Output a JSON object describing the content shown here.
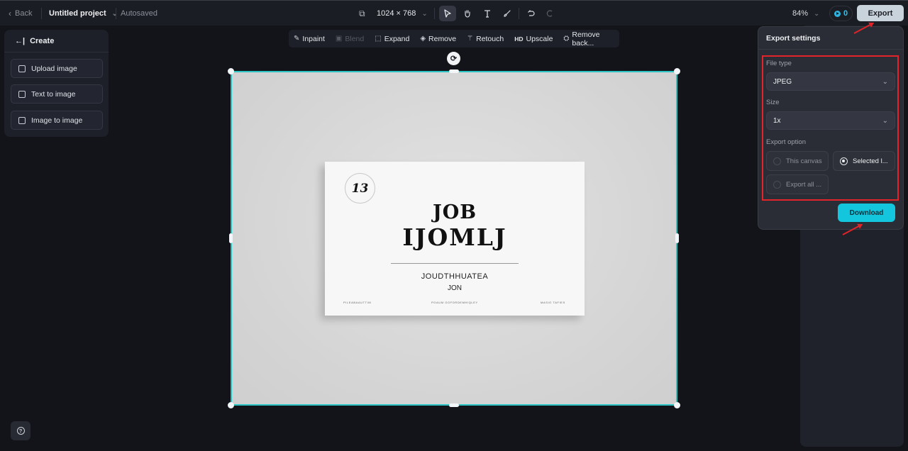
{
  "topbar": {
    "back_label": "Back",
    "project_name": "Untitled project",
    "save_status": "Autosaved",
    "canvas_size": "1024 × 768",
    "tools": [
      {
        "name": "select-tool",
        "icon": "cursor-icon",
        "active": true
      },
      {
        "name": "hand-tool",
        "icon": "hand-icon",
        "active": false
      },
      {
        "name": "text-tool",
        "icon": "text-icon",
        "active": false
      },
      {
        "name": "brush-tool",
        "icon": "brush-icon",
        "active": false
      }
    ],
    "undo_icon": "undo-icon",
    "redo_icon": "redo-icon",
    "zoom_level": "84%",
    "credits": "0",
    "export_label": "Export"
  },
  "create_panel": {
    "title": "Create",
    "items": [
      {
        "label": "Upload image",
        "icon": "upload-image-icon"
      },
      {
        "label": "Text to image",
        "icon": "text-to-image-icon"
      },
      {
        "label": "Image to image",
        "icon": "image-to-image-icon"
      }
    ]
  },
  "edit_toolbar": {
    "items": [
      {
        "label": "Inpaint",
        "icon": "inpaint-icon",
        "glyph": "✎",
        "disabled": false
      },
      {
        "label": "Blend",
        "icon": "blend-icon",
        "glyph": "▣",
        "disabled": true
      },
      {
        "label": "Expand",
        "icon": "expand-icon",
        "glyph": "⬚",
        "disabled": false
      },
      {
        "label": "Remove",
        "icon": "eraser-icon",
        "glyph": "◈",
        "disabled": false
      },
      {
        "label": "Retouch",
        "icon": "magic-wand-icon",
        "glyph": "⚚",
        "disabled": false
      },
      {
        "label": "Upscale",
        "icon": "hd-icon",
        "glyph": "HD",
        "disabled": false
      },
      {
        "label": "Remove back...",
        "icon": "remove-background-icon",
        "glyph": "⛭",
        "disabled": false
      }
    ]
  },
  "canvas_image": {
    "badge": "13",
    "title_line1": "JOB",
    "title_line2": "IJOMLJ",
    "subtitle_line1": "JOUDTHHUATEA",
    "subtitle_line2": "JON",
    "footer_left": "PILEABAAUTTIM",
    "footer_center": "POAUM GOFDRDEMHIQLEY",
    "footer_right": "MASIO TAFIES"
  },
  "export_settings": {
    "title": "Export settings",
    "file_type_label": "File type",
    "file_type_value": "JPEG",
    "size_label": "Size",
    "size_value": "1x",
    "export_option_label": "Export option",
    "options": [
      {
        "label": "This canvas",
        "selected": false
      },
      {
        "label": "Selected l...",
        "selected": true
      },
      {
        "label": "Export all ...",
        "selected": false
      }
    ],
    "download_label": "Download"
  },
  "colors": {
    "accent": "#13c6dd",
    "selection": "#2bc4c2",
    "annotation": "#e0242a"
  }
}
